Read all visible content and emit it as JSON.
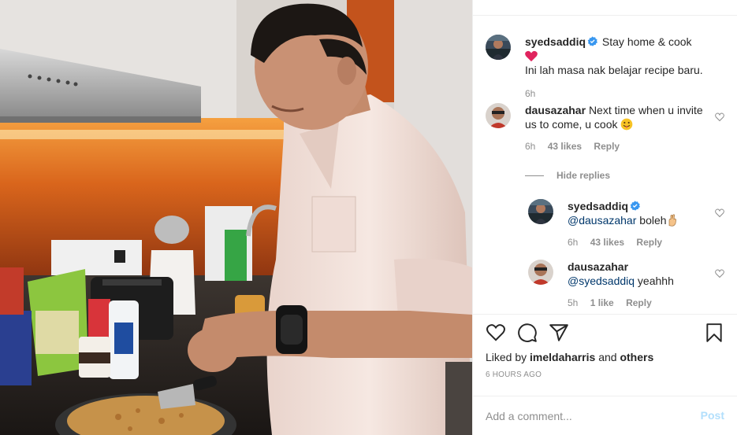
{
  "post": {
    "caption": {
      "username": "syedsaddiq",
      "line1": "Stay home & cook",
      "line2": "Ini lah masa nak belajar recipe baru.",
      "time": "6h"
    },
    "comments": [
      {
        "username": "dausazahar",
        "text": "Next time when u invite us to come, u cook",
        "time": "6h",
        "likes": "43 likes",
        "reply_label": "Reply"
      }
    ],
    "hide_replies_label": "Hide replies",
    "replies": [
      {
        "username": "syedsaddiq",
        "mention": "@dausazahar",
        "text": " boleh",
        "time": "6h",
        "likes": "43 likes",
        "reply_label": "Reply"
      },
      {
        "username": "dausazahar",
        "mention": "@syedsaddiq",
        "text": " yeahhh",
        "time": "5h",
        "likes": "1 like",
        "reply_label": "Reply"
      }
    ],
    "liked_by_prefix": "Liked by ",
    "liked_by_user": "imeldaharris",
    "liked_by_middle": " and ",
    "liked_by_others": "others",
    "timestamp": "6 HOURS AGO",
    "add_comment_placeholder": "Add a comment...",
    "post_label": "Post"
  },
  "icons": {
    "like": "heart-icon",
    "comment": "comment-bubble-icon",
    "share": "paper-plane-icon",
    "save": "bookmark-icon",
    "verified": "verified-badge-icon"
  },
  "colors": {
    "verified_blue": "#3897f0",
    "heart_red": "#ed4956",
    "muted": "#8e8e8e",
    "post_disabled": "#b2dffc",
    "mention": "#00376b"
  }
}
